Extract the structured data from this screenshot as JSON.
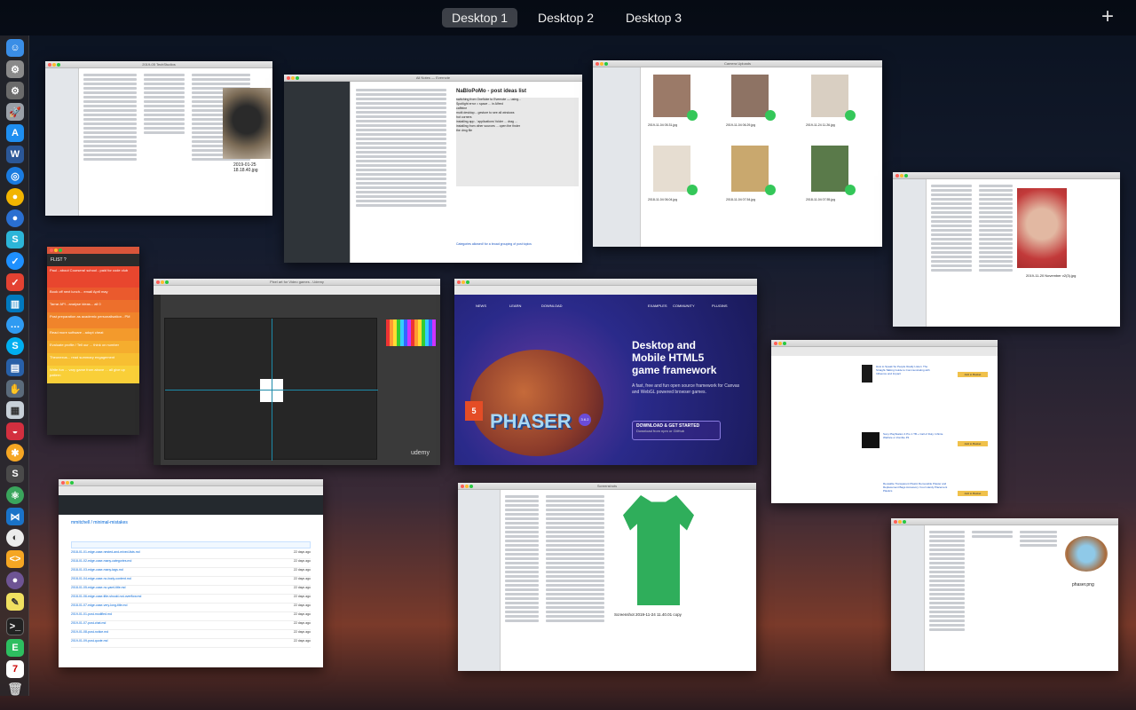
{
  "spaces": {
    "desktops": [
      "Desktop 1",
      "Desktop 2",
      "Desktop 3"
    ],
    "active_index": 0,
    "add_label": "+"
  },
  "dock": {
    "icons": [
      "finder-icon",
      "system-preferences-icon",
      "settings-icon",
      "launchpad-icon",
      "app-store-icon",
      "word-icon",
      "safari-icon",
      "chrome-icon",
      "browser-icon",
      "scrivener-icon",
      "todo-icon",
      "todoist-icon",
      "trello-icon",
      "messages-icon",
      "skype-icon",
      "aptana-icon",
      "hand-tool-icon",
      "pocket-icon",
      "app-icon",
      "sublime-icon",
      "atom-icon",
      "visual-studio-icon",
      "mac-app-icon",
      "github-icon",
      "text-app-icon",
      "terminal-icon",
      "evernote-icon",
      "calendar-icon",
      "trash-icon"
    ]
  },
  "windows": {
    "finder_photos": {
      "title": "2019-05 TechStudios",
      "caption": "2019-01-25 18.18.40.jpg"
    },
    "notes": {
      "title": "All Notes — Evernote",
      "note_title": "NaBloPoMo - post ideas list",
      "note_lines": [
        "switching from OneNote to Evernote — using...",
        "Spotlight error = space ... in Alfred",
        "caffeine",
        "multi desktop... gesture to see all windows",
        "hot corners",
        "installing app - 'applications' folder ... drag ...",
        "installing from other sources ... open the finder",
        "the dmg file"
      ],
      "footer": "Categories allowed! for a broad grouping of post topics"
    },
    "finder_camera": {
      "title": "Camera Uploads",
      "files": [
        "2019-11-04 05.31.jpg",
        "2019-11-04 06.29.jpg",
        "2019-11-24 11.26.jpg",
        "2018-11-04 06.04.jpg",
        "2018-11-04 07.54.jpg",
        "2018-11-04 07.55.jpg"
      ]
    },
    "finder_selfie": {
      "caption": "2019-11-20 November v2(3).jpg"
    },
    "todo_list": {
      "header": "FLIST ?",
      "items": [
        "Paul - about Coursera! school - paid for code club",
        "Book off next lunch... email April may",
        "Tarrar API - analyse ideas... all 0",
        "Post preparation as academic personalisation - PM",
        "Read more software - adopt cheat",
        "Evaluate profile / Tell our ... think on number",
        "Theonexus... read summary engagement",
        "Write fun ... vary game from above ... all give up pattern"
      ]
    },
    "photoshop": {
      "title": "Pixel art for Video games - Udemy",
      "brand": "udemy"
    },
    "phaser": {
      "heading_line1": "Desktop and",
      "heading_line2": "Mobile HTML5",
      "heading_line3": "game framework",
      "sub": "A fast, free and fun open source framework for Canvas and WebGL powered browser games.",
      "download": "DOWNLOAD & GET STARTED",
      "download_sub": "Download from npm or GitHub",
      "version": "3.6.2",
      "logo": "PHASER",
      "nav": [
        "NEWS",
        "LEARN",
        "DOWNLOAD",
        "EXAMPLES",
        "COMMUNITY",
        "PLUGINS"
      ]
    },
    "amazon": {
      "items": [
        "How to Speak So People Really Listen: The Straight-Talking Guide to Communicating with Influence and Impact",
        "Sony PlayStation 4 Pro 1 TB + Call of Duty: Infinite Warfare or Zombie Pit",
        "Reusable Transparent Plastic Removable Plaster and Replacement Bags Accessory: Four Handy Placement Plastics"
      ],
      "button": "Add to Basket"
    },
    "github": {
      "repo": "mmitchell / minimal-mistakes",
      "rows": [
        "2018-01-01-edge-case-nested-and-mixed-lists.md",
        "2018-01-02-edge-case-many-categories.md",
        "2018-01-03-edge-case-many-tags.md",
        "2018-01-04-edge-case-no-body-content.md",
        "2018-01-05-edge-case-no-yaml-title.md",
        "2018-01-06-edge-case-title-should-not-overflow.md",
        "2018-01-07-edge-case-very-long-title.md",
        "2019-01-01-post-modified.md",
        "2019-01-07-post-chat.md",
        "2019-01-08-post-notice.md",
        "2019-01-09-post-quote.md"
      ],
      "age": "22 days ago"
    },
    "screenshots": {
      "title": "Screenshots",
      "caption": "Screenshot 2019-11-24 11.40.01 copy"
    },
    "finder_phaser": {
      "caption": "phaser.png"
    }
  }
}
